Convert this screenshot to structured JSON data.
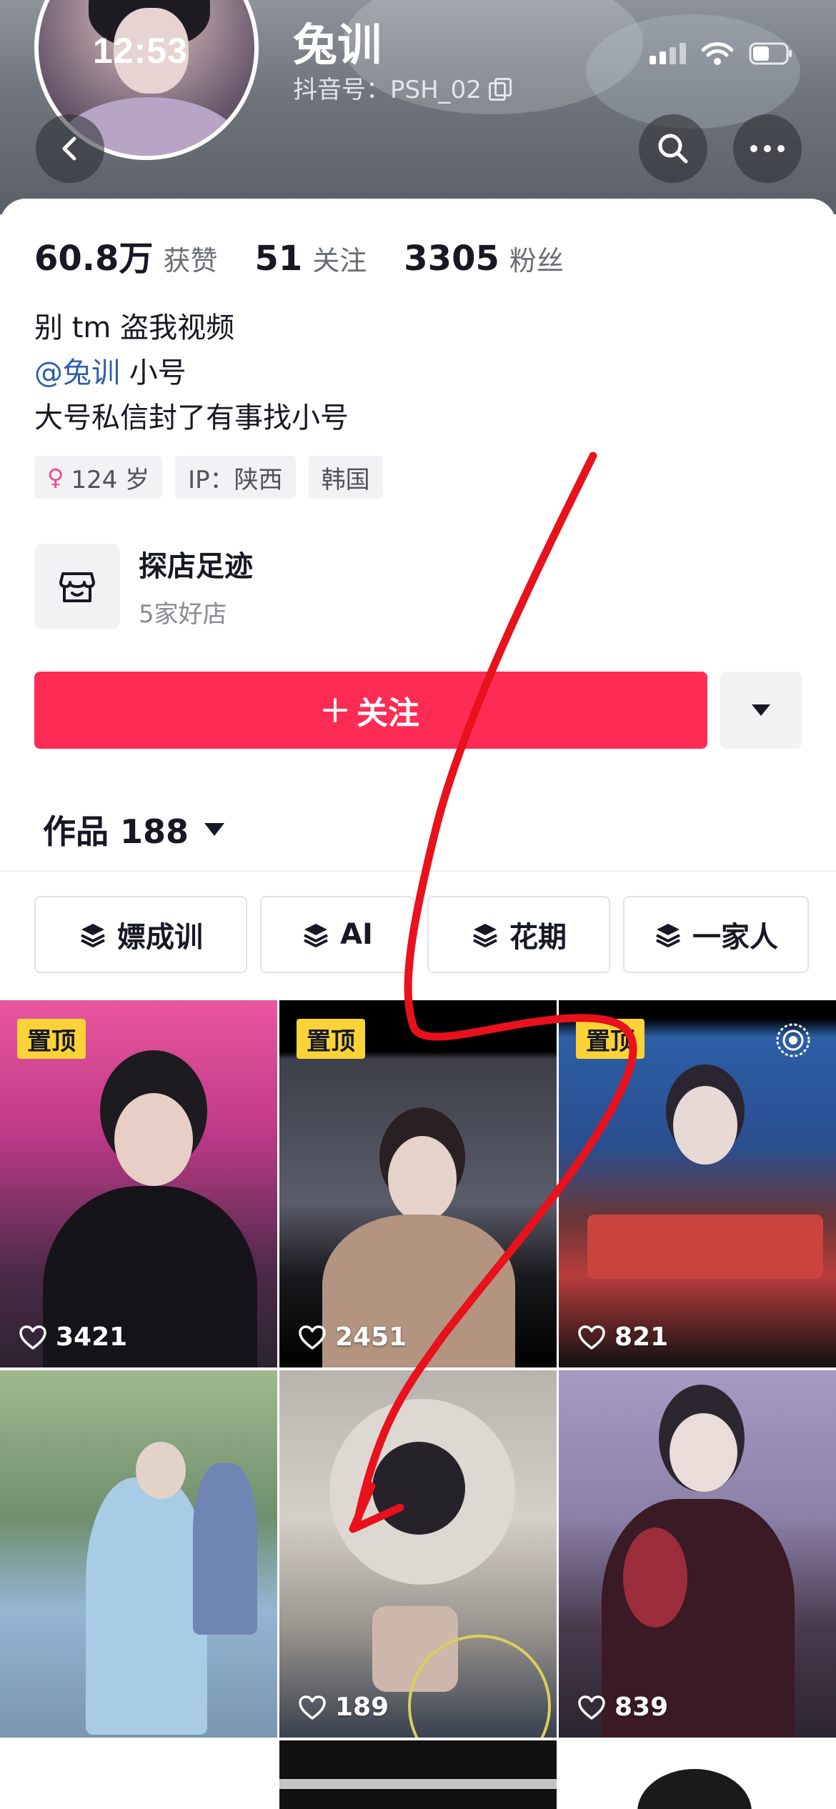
{
  "status_bar": {
    "time": "12:53"
  },
  "profile": {
    "nickname": "兔训",
    "douyin_id": "抖音号：PSH_02"
  },
  "stats": [
    {
      "value": "60.8万",
      "label": "获赞"
    },
    {
      "value": "51",
      "label": "关注"
    },
    {
      "value": "3305",
      "label": "粉丝"
    }
  ],
  "bio": {
    "line1": "别 tm 盗我视频",
    "mention": "@兔训",
    "mention_suffix": " 小号",
    "line3": "大号私信封了有事找小号"
  },
  "tags": [
    {
      "text": "124 岁",
      "icon": "female-icon"
    },
    {
      "text": "IP：陕西"
    },
    {
      "text": "韩国"
    }
  ],
  "shop": {
    "title": "探店足迹",
    "subtitle": "5家好店"
  },
  "follow_button": {
    "label": "关注",
    "icon": "plus-icon"
  },
  "works_tab": {
    "label": "作品 188"
  },
  "collections": [
    "嫖成训",
    "AI",
    "花期",
    "一家人"
  ],
  "videos": [
    {
      "pinned": true,
      "pin_label": "置顶",
      "likes": "3421"
    },
    {
      "pinned": true,
      "pin_label": "置顶",
      "likes": "2451"
    },
    {
      "pinned": true,
      "pin_label": "置顶",
      "likes": "821",
      "live": true
    },
    {
      "pinned": false,
      "likes": ""
    },
    {
      "pinned": false,
      "likes": "189"
    },
    {
      "pinned": false,
      "likes": "839"
    }
  ],
  "colors": {
    "accent": "#fe2c55",
    "pin": "#fcd336",
    "mention": "#2f5ea8",
    "annotation": "#e8111c"
  }
}
